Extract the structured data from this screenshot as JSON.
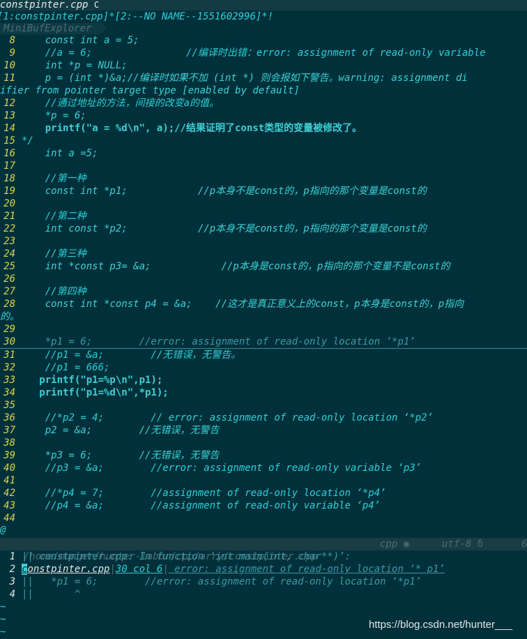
{
  "tabbar": {
    "filename": "constpinter.cpp",
    "icon": "C"
  },
  "buffers": {
    "text1": "[1:constpinter.cpp]*",
    "text2": "[2:--NO NAME--1551602996]*!"
  },
  "minibuf": {
    "label": "MiniBufExplorer"
  },
  "lines": [
    {
      "n": "8",
      "t": "    const int a = 5;"
    },
    {
      "n": "9",
      "t": "    //a = 6;                //编译时出错：error: assignment of read-only variable"
    },
    {
      "n": "10",
      "t": "    int *p = NULL;"
    },
    {
      "n": "11",
      "t": "    p = (int *)&a;//编译时如果不加 (int *) 则会报如下警告。warning: assignment di"
    },
    {
      "n": "",
      "t": "ifier from pointer target type [enabled by default]"
    },
    {
      "n": "12",
      "t": "    //通过地址的方法，间接的改变a的值。"
    },
    {
      "n": "13",
      "t": "    *p = 6;"
    },
    {
      "n": "14",
      "t": "    printf(\"a = %d\\n\", a);//结果证明了const类型的变量被修改了。"
    },
    {
      "n": "15",
      "t": "*/"
    },
    {
      "n": "16",
      "t": "    int a =5;"
    },
    {
      "n": "17",
      "t": ""
    },
    {
      "n": "18",
      "t": "    //第一种"
    },
    {
      "n": "19",
      "t": "    const int *p1;            //p本身不是const的，p指向的那个变量是const的"
    },
    {
      "n": "20",
      "t": ""
    },
    {
      "n": "21",
      "t": "    //第二种"
    },
    {
      "n": "22",
      "t": "    int const *p2;            //p本身不是const的，p指向的那个变量是const的"
    },
    {
      "n": "23",
      "t": ""
    },
    {
      "n": "24",
      "t": "    //第三种"
    },
    {
      "n": "25",
      "t": "    int *const p3= &a;            //p本身是const的，p指向的那个变量不是const的"
    },
    {
      "n": "26",
      "t": ""
    },
    {
      "n": "27",
      "t": "    //第四种"
    },
    {
      "n": "28",
      "t": "    const int *const p4 = &a;    //这才是真正意义上的const，p本身是const的，p指向"
    },
    {
      "n": "",
      "t": "的。"
    },
    {
      "n": "29",
      "t": ""
    },
    {
      "n": "30",
      "t": "    *p1 = 6;        //error: assignment of read-only location ‘*p1’"
    },
    {
      "n": "31",
      "t": "    //p1 = &a;        //无错误，无警告。"
    },
    {
      "n": "32",
      "t": "    //p1 = 666;"
    },
    {
      "n": "33",
      "t": "   printf(\"p1=%p\\n\",p1);"
    },
    {
      "n": "34",
      "t": "   printf(\"p1=%d\\n\",*p1);"
    },
    {
      "n": "35",
      "t": ""
    },
    {
      "n": "36",
      "t": "    //*p2 = 4;        // error: assignment of read-only location ‘*p2’"
    },
    {
      "n": "37",
      "t": "    p2 = &a;        //无错误，无警告"
    },
    {
      "n": "38",
      "t": ""
    },
    {
      "n": "39",
      "t": "    *p3 = 6;        //无错误，无警告"
    },
    {
      "n": "40",
      "t": "    //p3 = &a;        //error: assignment of read-only variable ‘p3’"
    },
    {
      "n": "41",
      "t": ""
    },
    {
      "n": "42",
      "t": "    //*p4 = 7;        //assignment of read-only location ‘*p4’"
    },
    {
      "n": "43",
      "t": "    //p4 = &a;        //assignment of read-only variable ‘p4’"
    },
    {
      "n": "44",
      "t": ""
    }
  ],
  "at_marker": "@",
  "statusbar": {
    "path": "/home/munger/hunter-labor/cpp/arry/constpinter.cpp",
    "filetype": "cpp",
    "encoding": "utf-8",
    "trailing": "6"
  },
  "quickfix": [
    {
      "n": "1",
      "pre": "|| constpinter.cpp: In function ‘int main(int, char**)’:"
    },
    {
      "n": "2",
      "file": "constpinter.cpp",
      "loc": "30 col 6",
      "msg": " error: assignment of read-only location ‘* p1’"
    },
    {
      "n": "3",
      "pre": "||   *p1 = 6;        //error: assignment of read-only location ‘*p1’"
    },
    {
      "n": "4",
      "pre": "||       ^"
    }
  ],
  "tildes": [
    "~",
    "~",
    "~"
  ],
  "watermark": "https://blog.csdn.net/hunter___"
}
